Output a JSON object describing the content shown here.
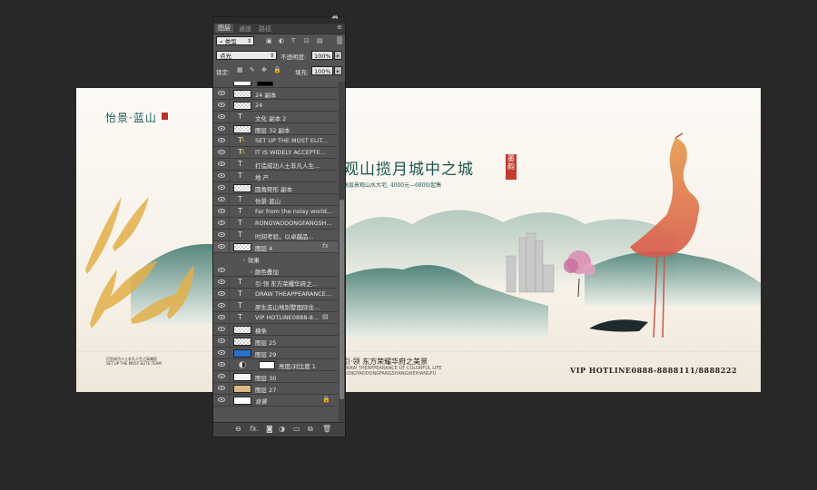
{
  "panel": {
    "menu_icon": "panel-menu-icon",
    "collapse_glyph": "◂◂",
    "close_glyph": "✕",
    "tabs": [
      "图层",
      "通道",
      "路径"
    ],
    "filter_kind": "类型",
    "blend_mode": "点光",
    "opacity_label": "不透明度:",
    "opacity_value": "100%",
    "lock_label": "锁定:",
    "fill_label": "填充:",
    "fill_value": "100%",
    "layers": [
      {
        "name": "24 副本",
        "kind": "raster"
      },
      {
        "name": "24",
        "kind": "raster"
      },
      {
        "name": "文化 副本 2",
        "kind": "text"
      },
      {
        "name": "图层 32 副本",
        "kind": "raster"
      },
      {
        "name": "SET UP THE MOST ELIT...",
        "kind": "warn"
      },
      {
        "name": "IT IS WIDELY ACCEPTE...",
        "kind": "warn"
      },
      {
        "name": "打造成功人士非凡人生...",
        "kind": "text"
      },
      {
        "name": "地  产",
        "kind": "text"
      },
      {
        "name": "圆角矩形 副本",
        "kind": "raster"
      },
      {
        "name": "怡景·蓝山",
        "kind": "text"
      },
      {
        "name": "Far from the noisy world...",
        "kind": "text"
      },
      {
        "name": "RONGYAODONGFANGSH...",
        "kind": "text"
      },
      {
        "name": "时间考验，以卓越品...",
        "kind": "text"
      },
      {
        "name": "图层 4",
        "kind": "raster",
        "fx": true
      },
      {
        "name": "效果",
        "kind": "effects"
      },
      {
        "name": "颜色叠加",
        "kind": "effect"
      },
      {
        "name": "引·领 东方荣耀华府之...",
        "kind": "text"
      },
      {
        "name": "DRAW THEAPPEARANCE...",
        "kind": "text"
      },
      {
        "name": "原生态山地别墅国际住...",
        "kind": "text"
      },
      {
        "name": "VIP HOTLINE0888-8...",
        "kind": "text",
        "fx": true
      },
      {
        "name": "横条",
        "kind": "raster"
      },
      {
        "name": "图层 25",
        "kind": "raster"
      },
      {
        "name": "图层 29",
        "kind": "blue"
      },
      {
        "name": "亮度/对比度 1",
        "kind": "adjust"
      },
      {
        "name": "图层 30",
        "kind": "raster"
      },
      {
        "name": "图层 27",
        "kind": "tan"
      },
      {
        "name": "背景",
        "kind": "background"
      }
    ],
    "fx_label": "fx",
    "bottom_icons": [
      "link-icon",
      "fx-icon",
      "mask-icon",
      "adjustment-icon",
      "folder-icon",
      "new-layer-icon",
      "trash-icon"
    ]
  },
  "poster": {
    "title": "怡景·蓝山",
    "headline": "观山揽月城中之城",
    "seal": "墨韵",
    "subline": "高层景观山水大宅, 4000元—6800/起售",
    "bottom_left": "打造成功人士非凡人生之高端居",
    "bottom_left_en": "SET UP THE MOST ELITE TEAM",
    "bottom_mid": "引·领 东方荣耀华府之美景",
    "bottom_mid_en": "DRAW THEAPPEARANCE OF COLORFUL LIFE",
    "bottom_mid_en2": "RONGYAODONGFANGSHANGWEIHANGFU",
    "hotline": "VIP HOTLINE0888-8888111/8888222",
    "colors": {
      "teal": "#1c5550",
      "seal_red": "#c43a2d",
      "gold": "#e0b040",
      "crane": "#e07050"
    }
  }
}
